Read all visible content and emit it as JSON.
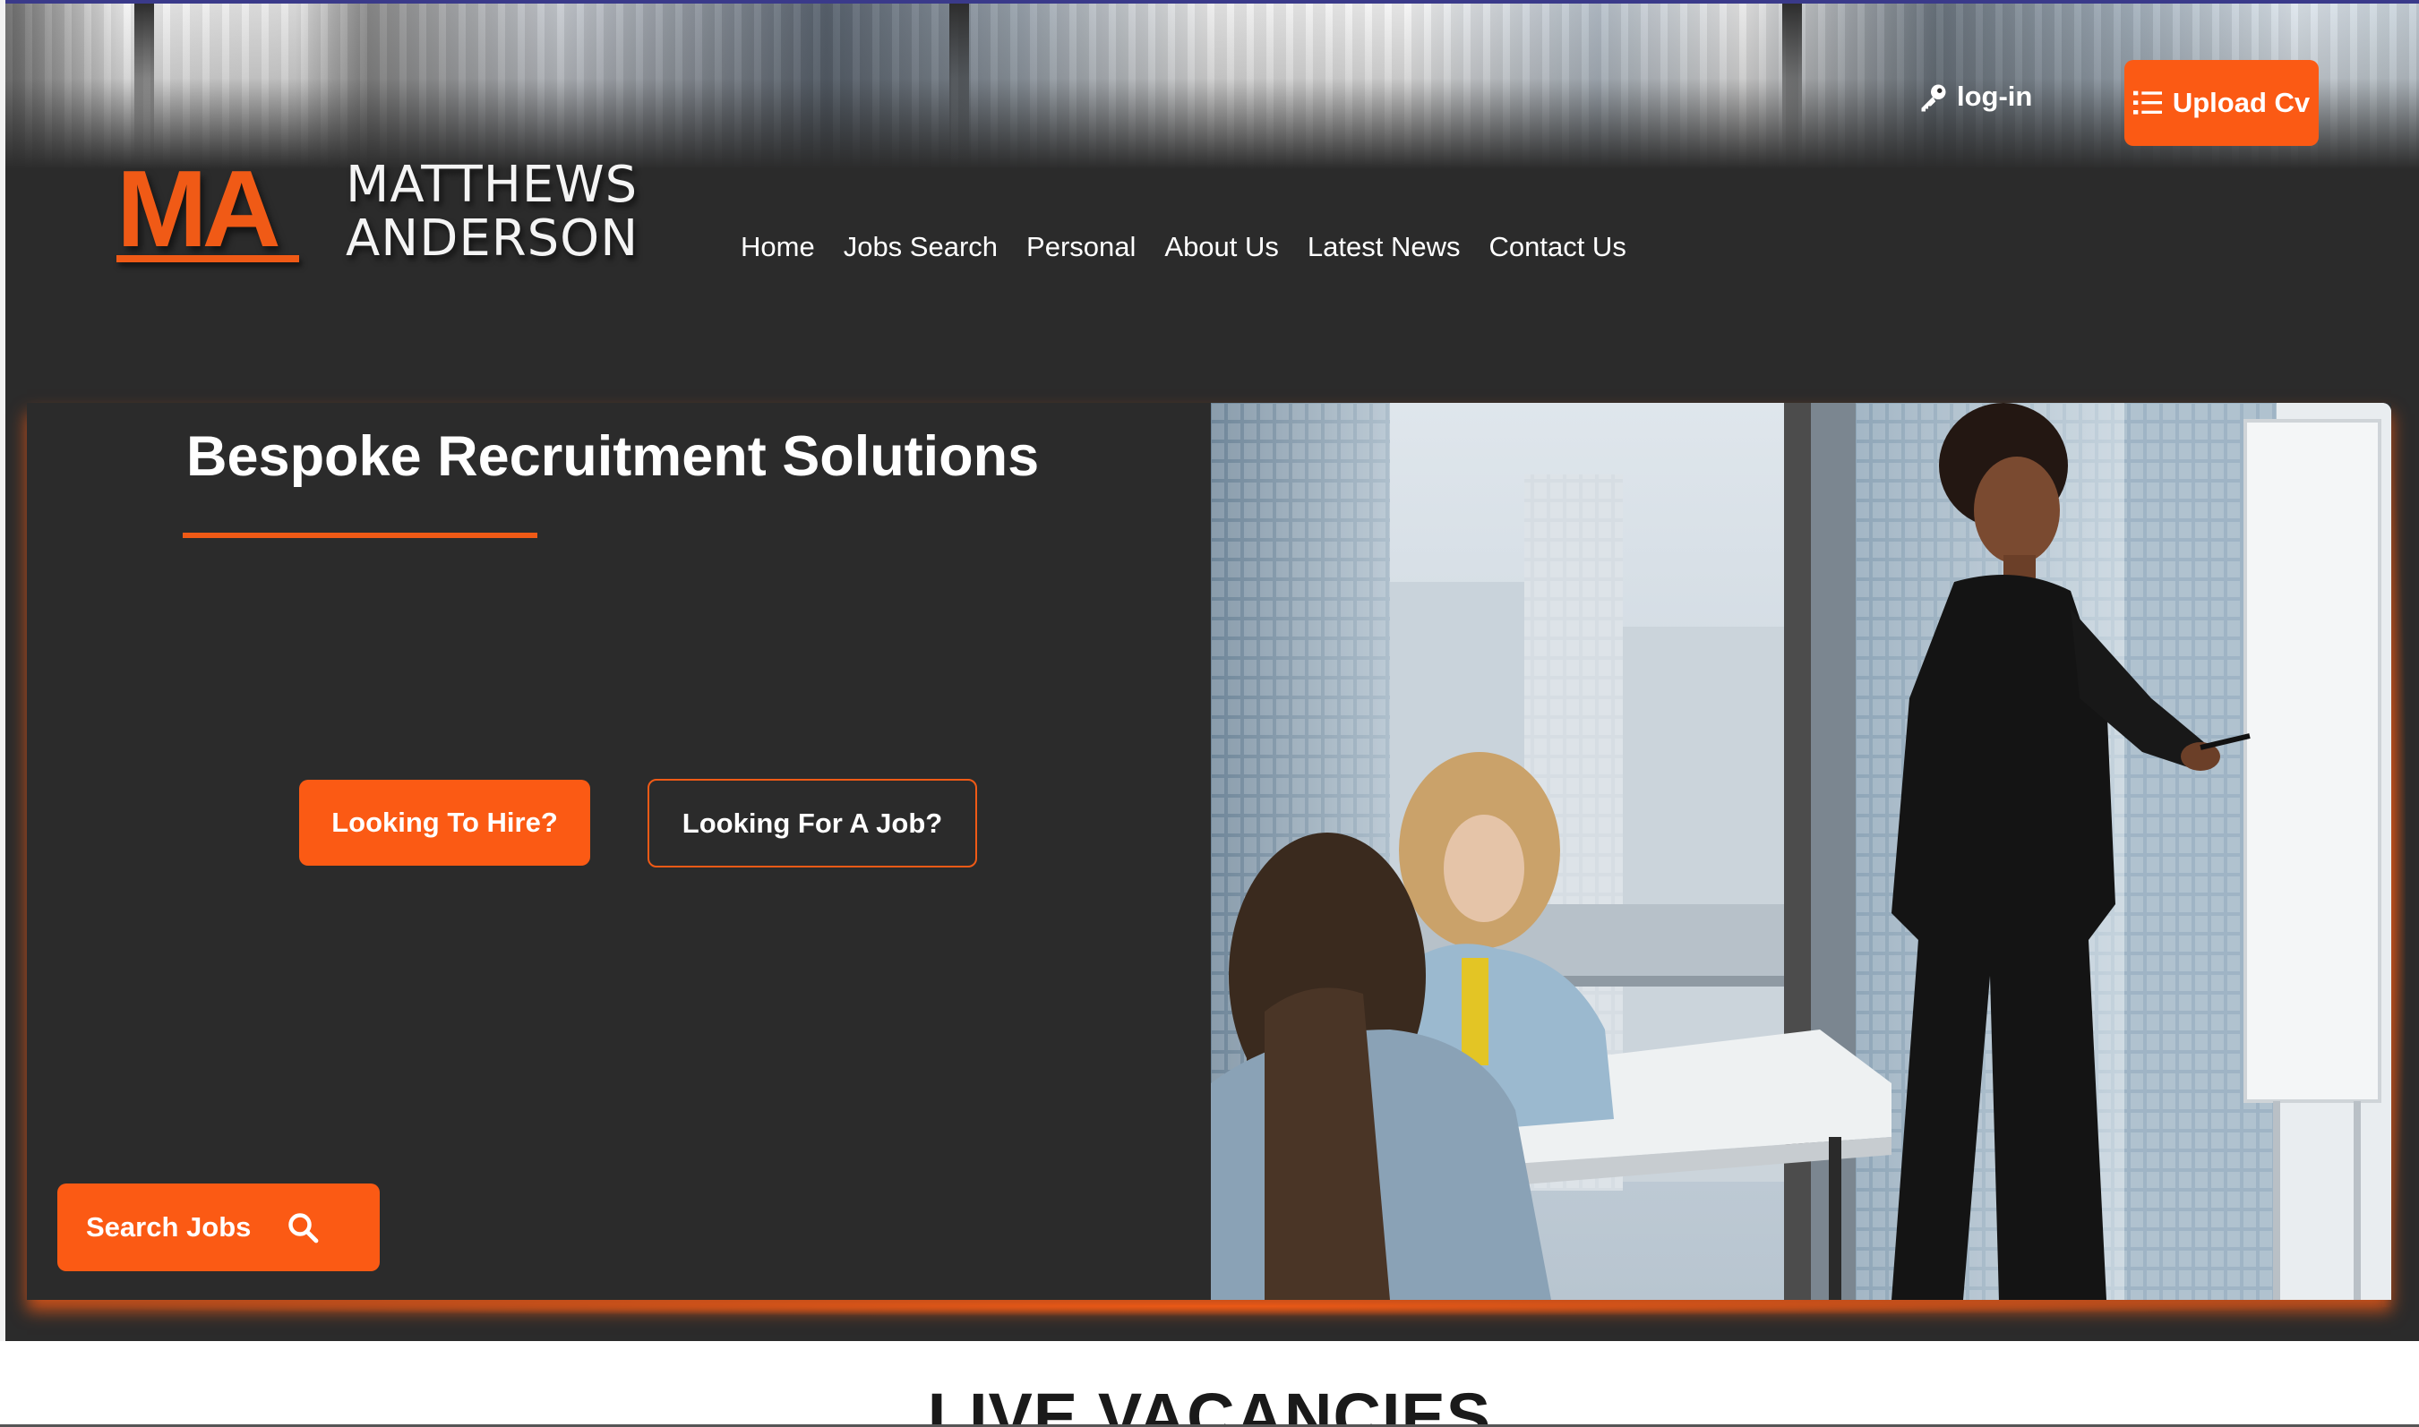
{
  "brand": {
    "initials": "MA",
    "name_line1": "MATTHEWS",
    "name_line2": "ANDERSON",
    "accent_color": "#f05a16"
  },
  "header": {
    "login_label": "log-in",
    "login_icon": "key-icon",
    "upload_label": "Upload Cv",
    "upload_icon": "list-icon"
  },
  "nav": {
    "items": [
      {
        "label": "Home"
      },
      {
        "label": "Jobs Search"
      },
      {
        "label": "Personal"
      },
      {
        "label": "About Us"
      },
      {
        "label": "Latest News"
      },
      {
        "label": "Contact Us"
      }
    ]
  },
  "hero": {
    "title": "Bespoke Recruitment Solutions",
    "hire_label": "Looking To Hire?",
    "job_label": "Looking For A Job?",
    "search_label": "Search Jobs",
    "search_icon": "search-icon"
  },
  "vacancies": {
    "title": "LIVE VACANCIES"
  }
}
